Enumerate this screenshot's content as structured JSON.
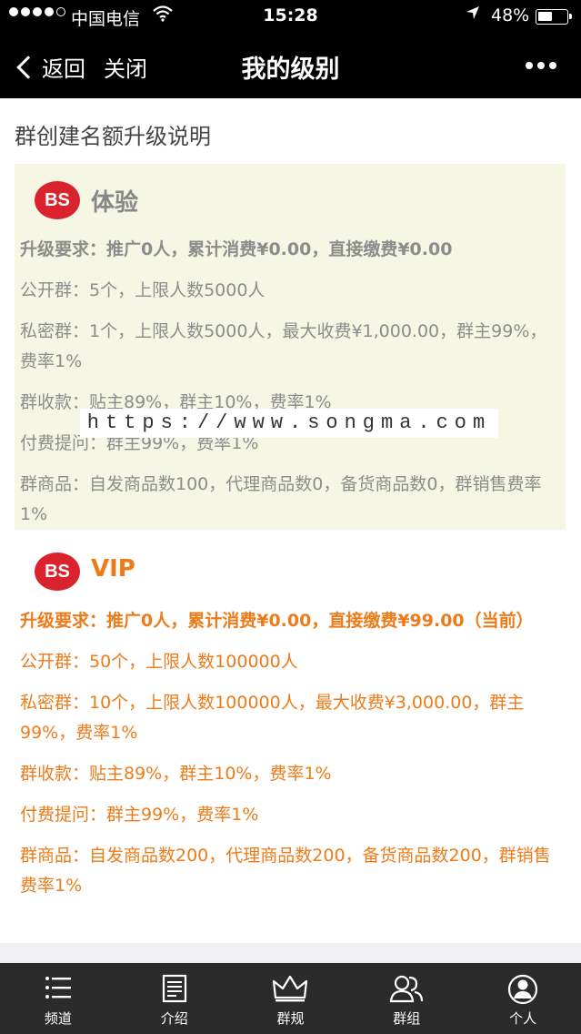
{
  "status": {
    "carrier": "中国电信",
    "time": "15:28",
    "battery": "48%",
    "battery_level": 0.48
  },
  "nav": {
    "back_label": "返回",
    "close_label": "关闭",
    "title": "我的级别"
  },
  "section_title": "群创建名额升级说明",
  "levels": [
    {
      "logo_text": "BS",
      "name": "体验",
      "lines": [
        "升级要求：推广0人，累计消费¥0.00，直接缴费¥0.00",
        "公开群：5个，上限人数5000人",
        "私密群：1个，上限人数5000人，最大收费¥1,000.00，群主99%，费率1%",
        "群收款：贴主89%，群主10%，费率1%",
        "付费提问：群主99%，费率1%",
        "群商品：自发商品数100，代理商品数0，备货商品数0，群销售费率1%"
      ]
    },
    {
      "logo_text": "BS",
      "name": "VIP",
      "lines": [
        "升级要求：推广0人，累计消费¥0.00，直接缴费¥99.00（当前）",
        "公开群：50个，上限人数100000人",
        "私密群：10个，上限人数100000人，最大收费¥3,000.00，群主99%，费率1%",
        "群收款：贴主89%，群主10%，费率1%",
        "付费提问：群主99%，费率1%",
        "群商品：自发商品数200，代理商品数200，备货商品数200，群销售费率1%"
      ]
    }
  ],
  "watermark": "https://www.songma.com",
  "tabs": [
    {
      "label": "频道",
      "icon": "list-icon"
    },
    {
      "label": "介绍",
      "icon": "document-icon"
    },
    {
      "label": "群规",
      "icon": "crown-icon"
    },
    {
      "label": "群组",
      "icon": "group-icon"
    },
    {
      "label": "个人",
      "icon": "person-icon"
    }
  ],
  "colors": {
    "vip_orange": "#ee7b1a",
    "trial_gray": "#8c8c8c",
    "logo_red": "#d9232d",
    "trial_bg": "#f5f7e4"
  }
}
